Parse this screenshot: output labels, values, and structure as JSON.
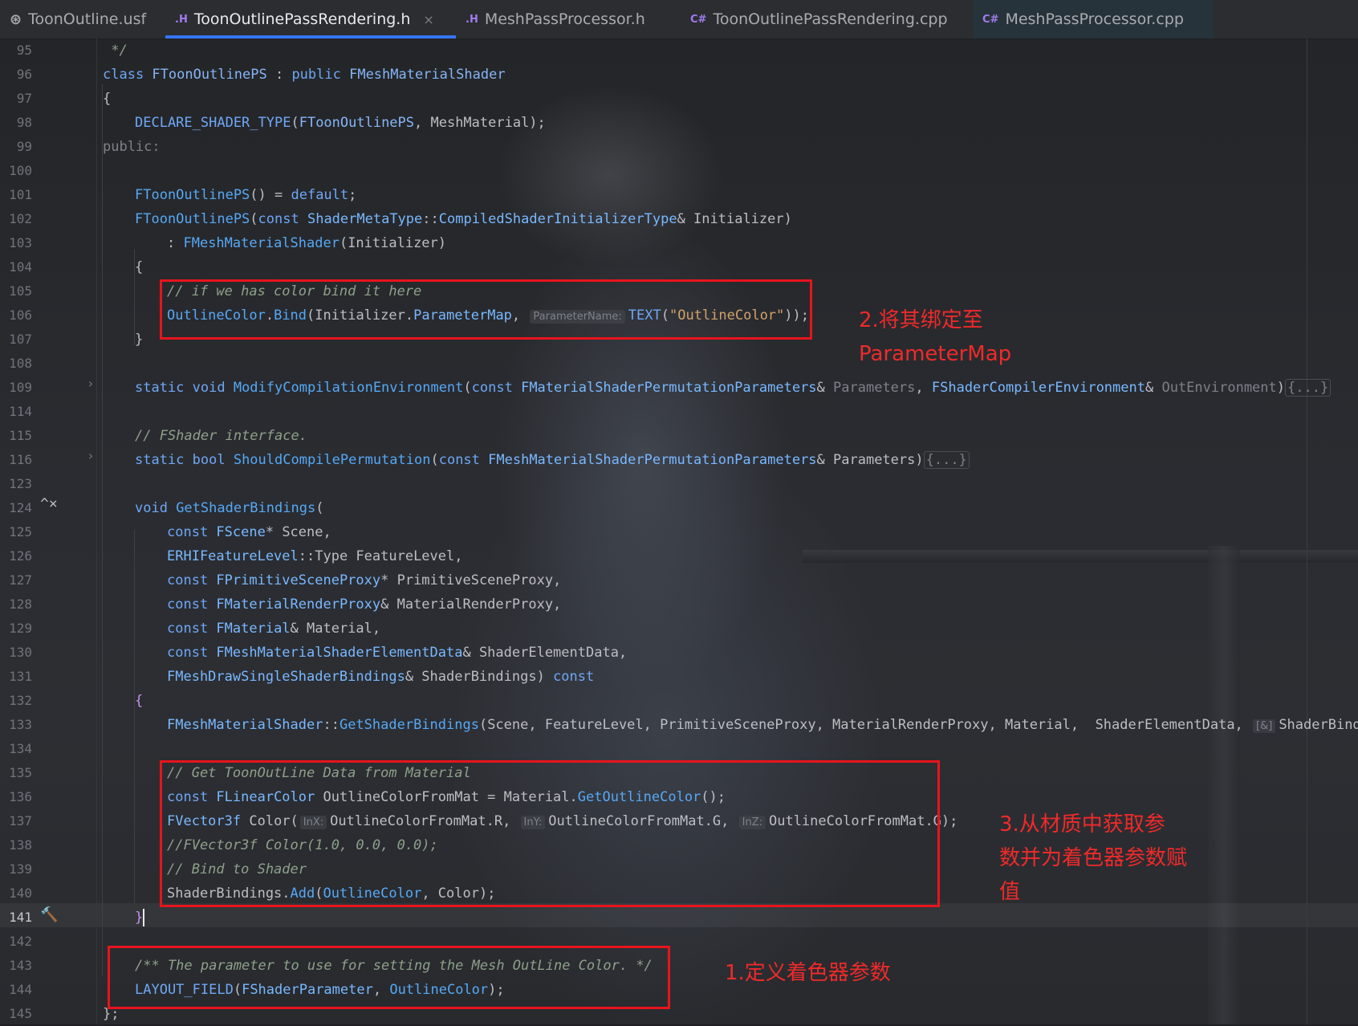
{
  "tabs": [
    {
      "icon": "shader-file-icon",
      "badge": "",
      "label": "ToonOutline.usf"
    },
    {
      "icon": "header-file-icon",
      "badge": ".H",
      "label": "ToonOutlinePassRendering.h",
      "close": "×"
    },
    {
      "icon": "header-file-icon",
      "badge": ".H",
      "label": "MeshPassProcessor.h"
    },
    {
      "icon": "cpp-file-icon",
      "badge": "C#",
      "label": "ToonOutlinePassRendering.cpp"
    },
    {
      "icon": "cpp-file-icon",
      "badge": "C#",
      "label": "MeshPassProcessor.cpp"
    }
  ],
  "line_numbers": [
    "95",
    "96",
    "97",
    "98",
    "99",
    "100",
    "101",
    "102",
    "103",
    "104",
    "105",
    "106",
    "107",
    "108",
    "109",
    "114",
    "115",
    "116",
    "123",
    "124",
    "125",
    "126",
    "127",
    "128",
    "129",
    "130",
    "131",
    "132",
    "133",
    "134",
    "135",
    "136",
    "137",
    "138",
    "139",
    "140",
    "141",
    "142",
    "143",
    "144",
    "145"
  ],
  "gutter_icons": {
    "override_icon": "^×",
    "hammer_icon": "🔨"
  },
  "code": {
    "l95": " */",
    "l96_kw": "class ",
    "l96_cls": "FToonOutlinePS",
    "l96_mid": " : ",
    "l96_kw2": "public ",
    "l96_base": "FMeshMaterialShader",
    "l97": "{",
    "l98_mac": "DECLARE_SHADER_TYPE",
    "l98_a": "(",
    "l98_cls": "FToonOutlinePS",
    "l98_b": ", MeshMaterial);",
    "l99": "public:",
    "l101_fn": "FToonOutlinePS",
    "l101_a": "() = ",
    "l101_kw": "default",
    "l101_b": ";",
    "l102_fn": "FToonOutlinePS",
    "l102_a": "(",
    "l102_kw": "const ",
    "l102_ty": "ShaderMetaType",
    "l102_b": "::",
    "l102_ty2": "CompiledShaderInitializerType",
    "l102_c": "& Initializer)",
    "l103_a": ": ",
    "l103_fn": "FMeshMaterialShader",
    "l103_b": "(Initializer)",
    "l104": "{",
    "l105": "// if we has color bind it here",
    "l106_a": "OutlineColor",
    "l106_b": ".",
    "l106_fn": "Bind",
    "l106_c": "(Initializer.",
    "l106_d": "ParameterMap",
    "l106_e": ", ",
    "l106_hint": "ParameterName:",
    "l106_mac": "TEXT",
    "l106_f": "(",
    "l106_str": "\"OutlineColor\"",
    "l106_g": "));",
    "l107": "}",
    "l109_kw": "static void ",
    "l109_fn": "ModifyCompilationEnvironment",
    "l109_a": "(",
    "l109_kw2": "const ",
    "l109_ty": "FMaterialShaderPermutationParameters",
    "l109_b": "& ",
    "l109_m1": "Parameters",
    "l109_c": ", ",
    "l109_ty2": "FShaderCompilerEnvironment",
    "l109_d": "& ",
    "l109_m2": "OutEnvironment",
    "l109_e": ")",
    "l109_fold": "{...}",
    "l115": "// FShader interface.",
    "l116_kw": "static bool ",
    "l116_fn": "ShouldCompilePermutation",
    "l116_a": "(",
    "l116_kw2": "const ",
    "l116_ty": "FMeshMaterialShaderPermutationParameters",
    "l116_b": "& Parameters)",
    "l116_fold": "{...}",
    "l124_kw": "void ",
    "l124_fn": "GetShaderBindings",
    "l124_a": "(",
    "l125_kw": "const ",
    "l125_ty": "FScene",
    "l125_a": "* Scene,",
    "l126_ty": "ERHIFeatureLevel",
    "l126_a": "::",
    "l126_b": "Type FeatureLevel,",
    "l127_kw": "const ",
    "l127_ty": "FPrimitiveSceneProxy",
    "l127_a": "* PrimitiveSceneProxy,",
    "l128_kw": "const ",
    "l128_ty": "FMaterialRenderProxy",
    "l128_a": "& MaterialRenderProxy,",
    "l129_kw": "const ",
    "l129_ty": "FMaterial",
    "l129_a": "& Material,",
    "l130_kw": "const ",
    "l130_ty": "FMeshMaterialShaderElementData",
    "l130_a": "& ShaderElementData,",
    "l131_ty": "FMeshDrawSingleShaderBindings",
    "l131_a": "& ShaderBindings) ",
    "l131_kw": "const",
    "l132": "{",
    "l133_ty": "FMeshMaterialShader",
    "l133_a": "::",
    "l133_fn": "GetShaderBindings",
    "l133_b": "(Scene, FeatureLevel, PrimitiveSceneProxy, MaterialRenderProxy, Material,  ShaderElementData, ",
    "l133_hint": "[&]",
    "l133_c": "ShaderBindings",
    "l135": "// Get ToonOutLine Data from Material",
    "l136_kw": "const ",
    "l136_ty": "FLinearColor",
    "l136_a": " OutlineColorFromMat = Material.",
    "l136_fn": "GetOutlineColor",
    "l136_b": "();",
    "l137_ty": "FVector3f",
    "l137_a": " Color(",
    "l137_h1": "InX:",
    "l137_b": "OutlineColorFromMat.R, ",
    "l137_h2": "InY:",
    "l137_c": "OutlineColorFromMat.G, ",
    "l137_h3": "InZ:",
    "l137_d": "OutlineColorFromMat.G);",
    "l138": "//FVector3f Color(1.0, 0.0, 0.0);",
    "l139": "// Bind to Shader",
    "l140_a": "ShaderBindings.",
    "l140_fn": "Add",
    "l140_b": "(",
    "l140_c": "OutlineColor",
    "l140_d": ", Color);",
    "l141": "}",
    "l143": "/** The parameter to use for setting the Mesh OutLine Color. */",
    "l144_mac": "LAYOUT_FIELD",
    "l144_a": "(",
    "l144_ty": "FShaderParameter",
    "l144_b": ", ",
    "l144_c": "OutlineColor",
    "l144_d": ");",
    "l145": "};"
  },
  "annotations": {
    "note1": "1.定义着色器参数",
    "note2": "2.将其绑定至\nParameterMap",
    "note3": "3.从材质中获取参\n数并为着色器参数赋\n值"
  },
  "colors": {
    "annotation": "#e8141c",
    "tab_underline": "#3574f0",
    "editor_bg": "#1f2023"
  }
}
